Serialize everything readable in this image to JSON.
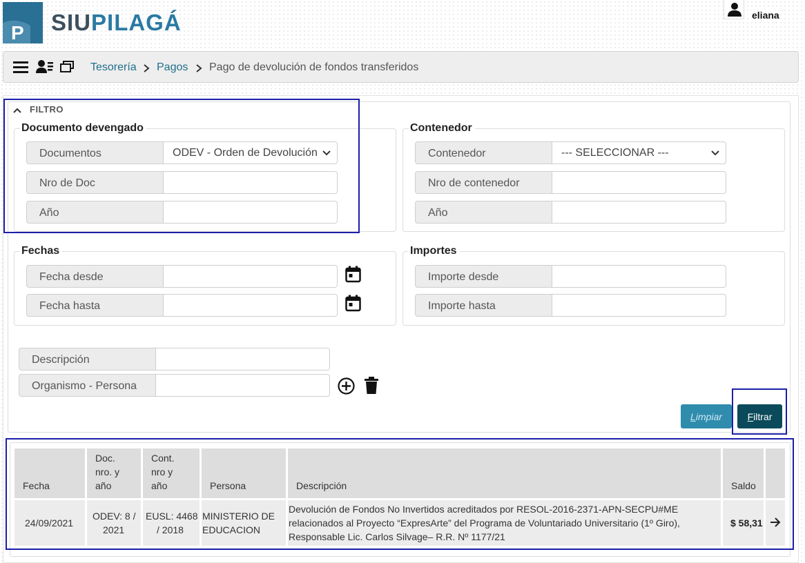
{
  "header": {
    "logo_part1": "SIU",
    "logo_part2": "PILAGÁ",
    "logo_letter": "P",
    "username": "eliana"
  },
  "breadcrumb": {
    "items": [
      "Tesorería",
      "Pagos",
      "Pago de devolución de fondos transferidos"
    ]
  },
  "filter": {
    "title": "FILTRO",
    "documento": {
      "legend": "Documento devengado",
      "documentos_label": "Documentos",
      "documentos_value": "ODEV - Orden de Devolución",
      "nro_label": "Nro de Doc",
      "nro_value": "",
      "anio_label": "Año",
      "anio_value": ""
    },
    "contenedor": {
      "legend": "Contenedor",
      "contenedor_label": "Contenedor",
      "contenedor_value": "--- SELECCIONAR ---",
      "nro_label": "Nro de contenedor",
      "nro_value": "",
      "anio_label": "Año",
      "anio_value": ""
    },
    "fechas": {
      "legend": "Fechas",
      "desde_label": "Fecha desde",
      "desde_value": "",
      "hasta_label": "Fecha hasta",
      "hasta_value": ""
    },
    "importes": {
      "legend": "Importes",
      "desde_label": "Importe desde",
      "desde_value": "",
      "hasta_label": "Importe hasta",
      "hasta_value": ""
    },
    "descripcion_label": "Descripción",
    "descripcion_value": "",
    "organismo_label": "Organismo - Persona",
    "organismo_value": "",
    "limpiar_label": "Limpiar",
    "filtrar_label": "Filtrar"
  },
  "table": {
    "headers": {
      "fecha": "Fecha",
      "doc_l1": "Doc.",
      "doc_l2": "nro. y",
      "doc_l3": "año",
      "cont_l1": "Cont.",
      "cont_l2": "nro y",
      "cont_l3": "año",
      "persona": "Persona",
      "descripcion": "Descripción",
      "saldo": "Saldo"
    },
    "row": {
      "fecha": "24/09/2021",
      "doc_l1": "ODEV: 8 /",
      "doc_l2": "2021",
      "cont_l1": "EUSL: 4468",
      "cont_l2": "/ 2018",
      "persona_l1": "MINISTERIO DE",
      "persona_l2": "EDUCACION",
      "desc_l1": "Devolución de Fondos No Invertidos acreditados por RESOL-2016-2371-APN-SECPU#ME",
      "desc_l2": "relacionados al Proyecto “ExpresArte” del Programa de Voluntariado Universitario (1º Giro),",
      "desc_l3": "Responsable Lic. Carlos Silvage– R.R. Nº 1177/21",
      "saldo": "$ 58,31"
    }
  },
  "colors": {
    "primary": "#0b4a5a",
    "secondary": "#2f8cad",
    "link": "#1f6e8c",
    "highlight": "#1b1ea8"
  },
  "icons": [
    "menu-icon",
    "users-icon",
    "windows-icon",
    "chevron-right-icon",
    "chevron-up-icon",
    "chevron-down-icon",
    "calendar-icon",
    "plus-circle-icon",
    "trash-icon",
    "arrow-right-icon",
    "user-icon"
  ]
}
